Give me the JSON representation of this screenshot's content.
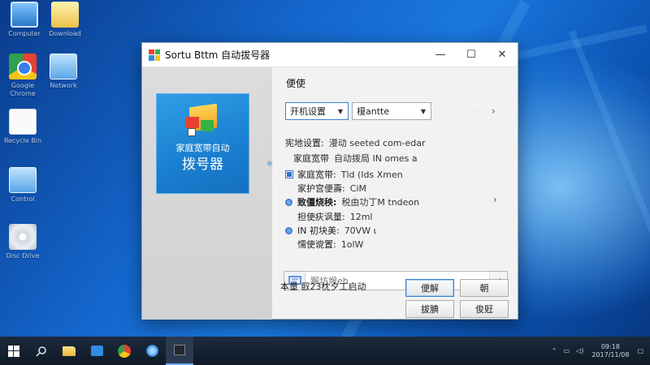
{
  "desktop": {
    "icons": [
      {
        "name": "desktop-icon-pc",
        "caption": "Computer",
        "kind": "pc"
      },
      {
        "name": "desktop-icon-folder",
        "caption": "Download",
        "kind": "folder"
      },
      {
        "name": "desktop-icon-chrome",
        "caption": "Google Chrome",
        "kind": "chrome"
      },
      {
        "name": "desktop-icon-network",
        "caption": "Network",
        "kind": "net"
      },
      {
        "name": "desktop-icon-doc",
        "caption": "Recycle Bin",
        "kind": "doc"
      },
      {
        "name": "desktop-icon-control",
        "caption": "Control",
        "kind": "net"
      },
      {
        "name": "desktop-icon-disc",
        "caption": "Disc Drive",
        "kind": "disc"
      }
    ]
  },
  "window": {
    "title": "Sortu Bttm 自动拔号器",
    "minimize": "—",
    "maximize": "☐",
    "close": "✕",
    "splash_line1": "家庭宽带自动",
    "splash_line2": "拨号器",
    "section_title": "便使",
    "select1": "开机设置",
    "select2": "榎antte",
    "rows": {
      "r1_label": "宪地设置:",
      "r1_value": "漫动 seeted com-edar",
      "r2_label": "家庭宽带",
      "r2_value": "自动拨局 IN omes a",
      "r3_label": "家庭宽带:",
      "r3_value": "Tld (Ids Xmen",
      "r4_label": "家护宫便壽:",
      "r4_value": "CiM",
      "r5_label": "致僵烧秧:",
      "r5_value": "税由功丁M tndeon",
      "r6_label": "担使疢讽量:",
      "r6_value": "12ml",
      "r7_label": "IN 初块美:",
      "r7_value": "70VW  ι",
      "r8_label": "懦使谠置:",
      "r8_value": "1olW"
    },
    "search_placeholder": "獬坊堠eh",
    "status": "本量 臤23枕夕工启动",
    "buttons": {
      "connect": "便解",
      "exit": "朝",
      "switch": "拔腆",
      "settings": "俊覎"
    }
  },
  "taskbar": {
    "clock_time": "09:18",
    "clock_date": "2017/11/08"
  },
  "colors": {
    "accent": "#3c7fd6",
    "splash_bg": "#1a7fd0",
    "taskbar": "#101a27"
  }
}
